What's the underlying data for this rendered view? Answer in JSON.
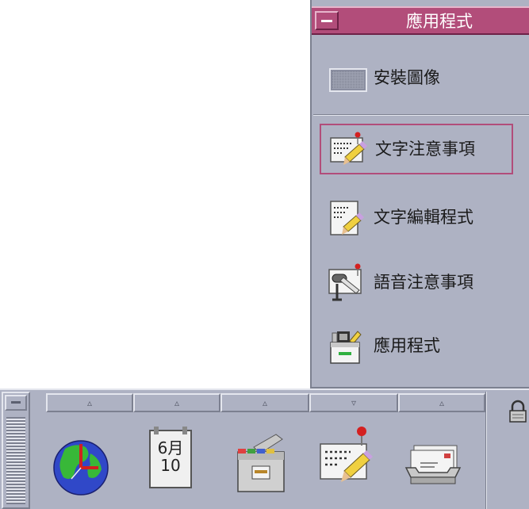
{
  "subpanel": {
    "title": "應用程式",
    "items": [
      {
        "label": "安裝圖像",
        "icon": "install-icons-drop-icon",
        "selected": false
      },
      {
        "label": "文字注意事項",
        "icon": "text-note-icon",
        "selected": true
      },
      {
        "label": "文字編輯程式",
        "icon": "text-editor-icon",
        "selected": false
      },
      {
        "label": "語音注意事項",
        "icon": "voice-note-icon",
        "selected": false
      },
      {
        "label": "應用程式",
        "icon": "application-manager-icon",
        "selected": false
      }
    ]
  },
  "frontpanel": {
    "arrows": [
      "▵",
      "▵",
      "▵",
      "▿",
      "▵"
    ],
    "calendar": {
      "month": "6月",
      "day": "10"
    },
    "icons": [
      "clock-globe-icon",
      "calendar-icon",
      "file-manager-icon",
      "text-note-icon",
      "mailer-icon"
    ]
  },
  "colors": {
    "accent": "#b24d7a",
    "panel": "#aeb2c3"
  }
}
